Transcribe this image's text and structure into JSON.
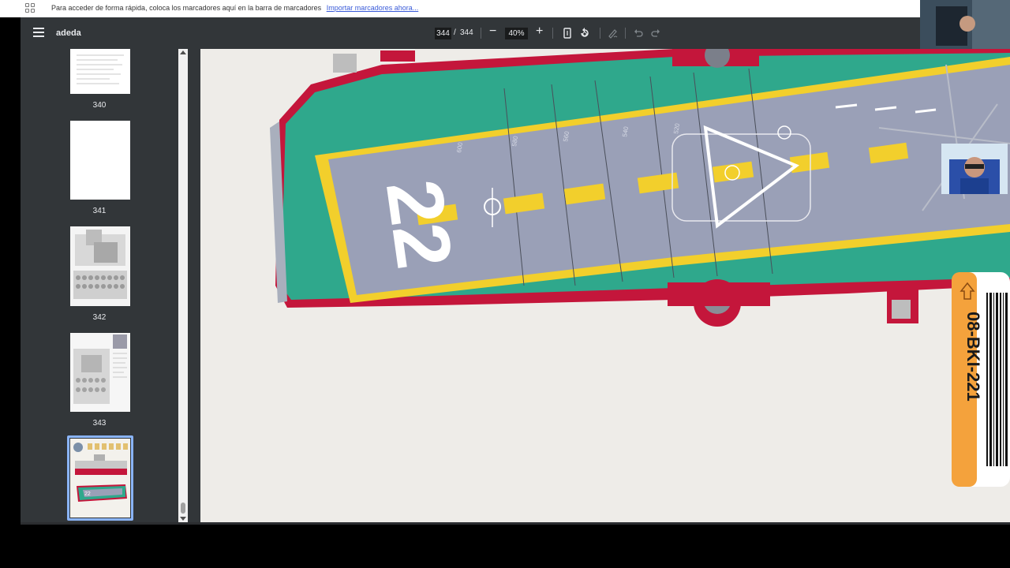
{
  "bookmarks_bar": {
    "message": "Para acceder de forma rápida, coloca los marcadores aquí en la barra de marcadores",
    "import_link": "Importar marcadores ahora..."
  },
  "toolbar": {
    "title": "adeda",
    "current_page": "344",
    "separator": "/",
    "total_pages": "344",
    "zoom": "40%"
  },
  "sidebar": {
    "thumbnails": [
      {
        "label": "340"
      },
      {
        "label": "341"
      },
      {
        "label": "342"
      },
      {
        "label": "343"
      },
      {
        "label": "",
        "selected": true
      }
    ]
  },
  "document": {
    "deck_number": "22",
    "deck_marks": [
      "480",
      "500",
      "520",
      "540",
      "560",
      "580",
      "600"
    ],
    "library_label": "08-BKI-221"
  },
  "colors": {
    "hull_red": "#c4163b",
    "deck_green": "#2fa88c",
    "deck_gray": "#9aa0b7",
    "deck_yellow": "#f2cf2c",
    "toolbar_bg": "#323639",
    "tag_orange": "#f4a23c"
  },
  "icons": [
    "apps-icon",
    "menu-icon",
    "fit-page-icon",
    "rotate-icon",
    "annotate-icon",
    "undo-icon",
    "redo-icon"
  ]
}
